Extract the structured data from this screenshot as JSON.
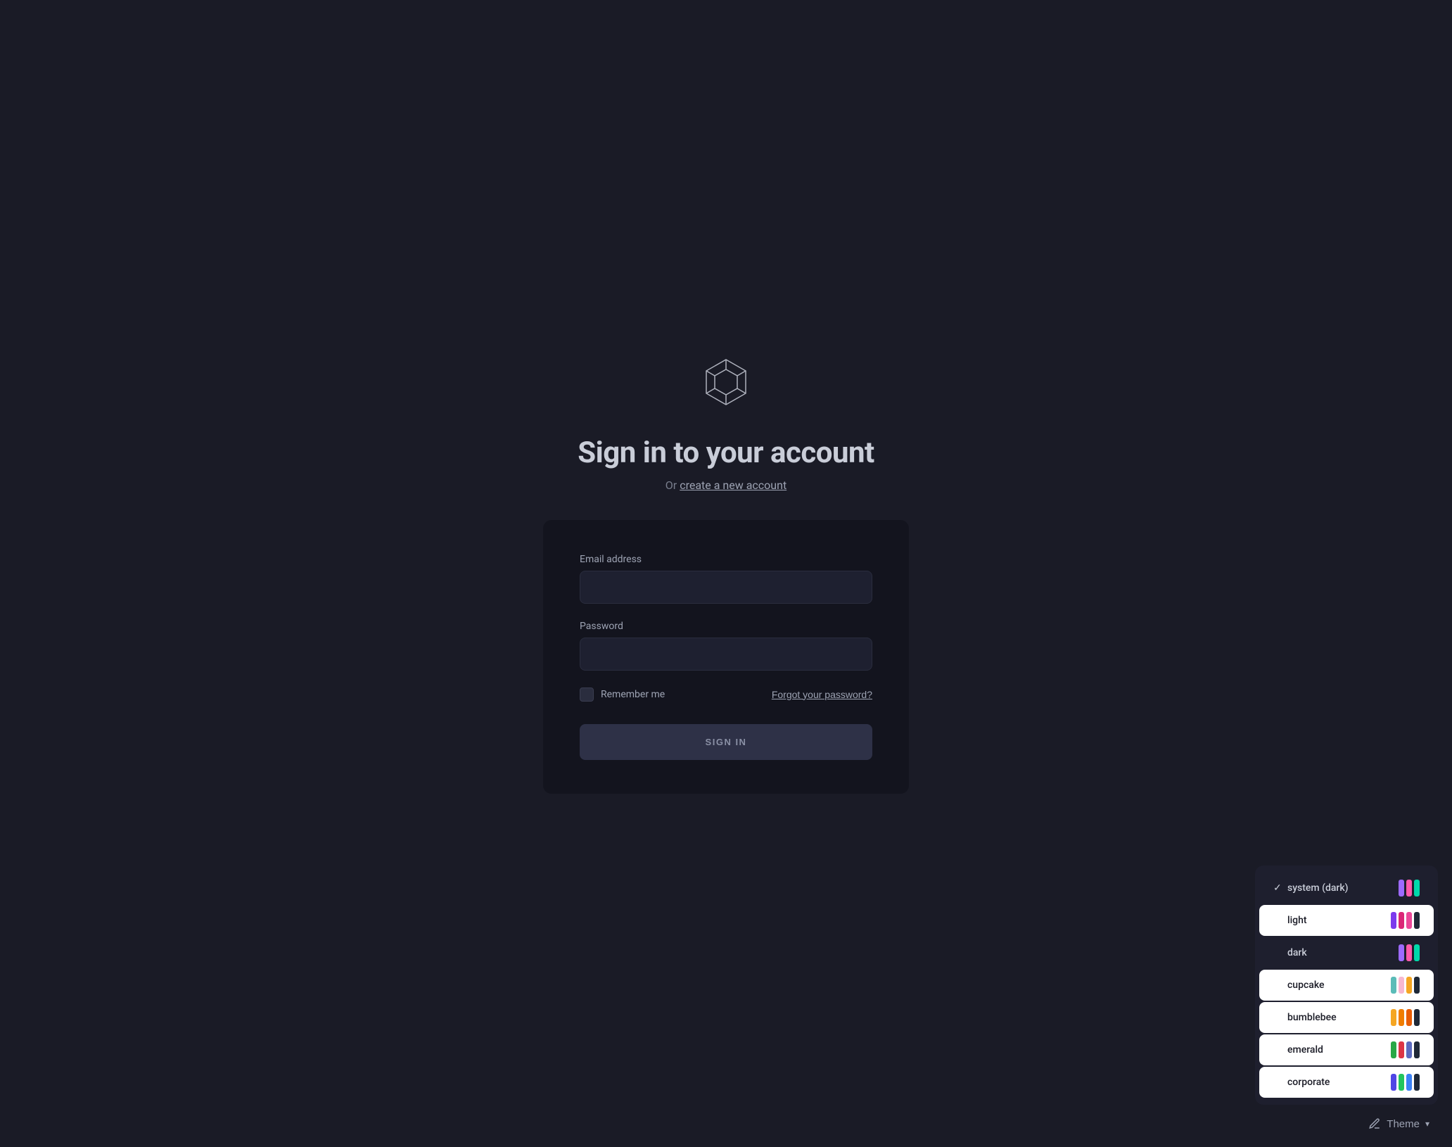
{
  "page": {
    "background_color": "#1a1b26",
    "title": "Sign in to your account",
    "subtitle_prefix": "Or ",
    "subtitle_link_text": "create a new account"
  },
  "form": {
    "email_label": "Email address",
    "email_placeholder": "",
    "password_label": "Password",
    "password_placeholder": "",
    "remember_label": "Remember me",
    "forgot_label": "Forgot your password?",
    "submit_label": "SIGN IN"
  },
  "theme_panel": {
    "items": [
      {
        "id": "system-dark",
        "name": "system (dark)",
        "selected": true,
        "bg": "dark",
        "swatches": [
          "#9d6aff",
          "#ff5aaa",
          "#00d9aa"
        ]
      },
      {
        "id": "light",
        "name": "light",
        "selected": false,
        "bg": "white",
        "swatches": [
          "#7c3aed",
          "#db2777",
          "#ec4899",
          "#1f2937"
        ]
      },
      {
        "id": "dark",
        "name": "dark",
        "selected": false,
        "bg": "dark",
        "swatches": [
          "#9d6aff",
          "#ff5aaa",
          "#00d9aa"
        ]
      },
      {
        "id": "cupcake",
        "name": "cupcake",
        "selected": false,
        "bg": "white",
        "swatches": [
          "#5bbcb8",
          "#f7b8d0",
          "#f5a623",
          "#1f2937"
        ]
      },
      {
        "id": "bumblebee",
        "name": "bumblebee",
        "selected": false,
        "bg": "white",
        "swatches": [
          "#f5a623",
          "#f07d00",
          "#e85d04",
          "#1f2937"
        ]
      },
      {
        "id": "emerald",
        "name": "emerald",
        "selected": false,
        "bg": "white",
        "swatches": [
          "#28a745",
          "#dc3545",
          "#5c6bc0",
          "#1f2937"
        ]
      },
      {
        "id": "corporate",
        "name": "corporate",
        "selected": false,
        "bg": "white",
        "swatches": [
          "#4f46e5",
          "#22c55e",
          "#3b82f6",
          "#1f2937"
        ]
      }
    ],
    "footer_label": "Theme",
    "footer_icon": "🎨"
  }
}
